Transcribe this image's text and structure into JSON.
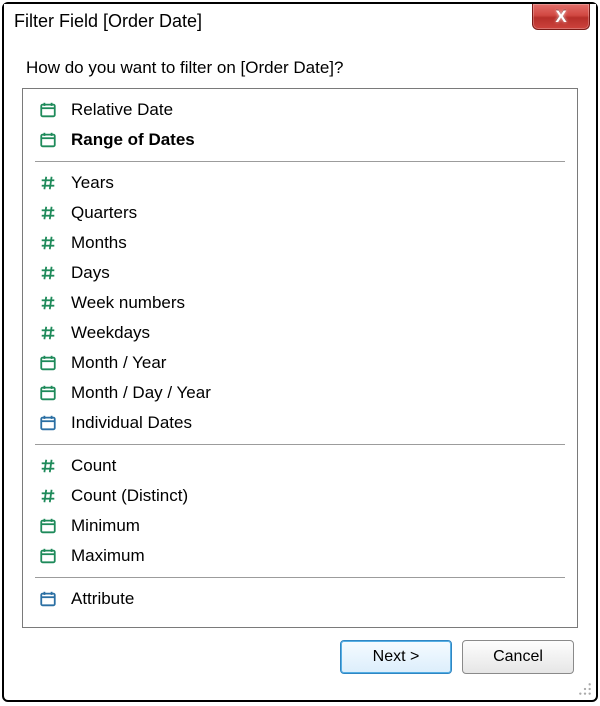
{
  "window": {
    "title": "Filter Field [Order Date]"
  },
  "prompt": "How do you want to filter on [Order Date]?",
  "groups": [
    {
      "items": [
        {
          "label": "Relative Date",
          "icon": "calendar",
          "color": "#1e8a5a",
          "selected": false
        },
        {
          "label": "Range of Dates",
          "icon": "calendar",
          "color": "#1e8a5a",
          "selected": true
        }
      ]
    },
    {
      "items": [
        {
          "label": "Years",
          "icon": "hash",
          "color": "#1e8a5a"
        },
        {
          "label": "Quarters",
          "icon": "hash",
          "color": "#1e8a5a"
        },
        {
          "label": "Months",
          "icon": "hash",
          "color": "#1e8a5a"
        },
        {
          "label": "Days",
          "icon": "hash",
          "color": "#1e8a5a"
        },
        {
          "label": "Week numbers",
          "icon": "hash",
          "color": "#1e8a5a"
        },
        {
          "label": "Weekdays",
          "icon": "hash",
          "color": "#1e8a5a"
        },
        {
          "label": "Month / Year",
          "icon": "calendar",
          "color": "#1e8a5a"
        },
        {
          "label": "Month / Day / Year",
          "icon": "calendar",
          "color": "#1e8a5a"
        },
        {
          "label": "Individual Dates",
          "icon": "calendar",
          "color": "#2b6fa3"
        }
      ]
    },
    {
      "items": [
        {
          "label": "Count",
          "icon": "hash",
          "color": "#1e8a5a"
        },
        {
          "label": "Count (Distinct)",
          "icon": "hash",
          "color": "#1e8a5a"
        },
        {
          "label": "Minimum",
          "icon": "calendar",
          "color": "#1e8a5a"
        },
        {
          "label": "Maximum",
          "icon": "calendar",
          "color": "#1e8a5a"
        }
      ]
    },
    {
      "items": [
        {
          "label": "Attribute",
          "icon": "calendar",
          "color": "#2b6fa3"
        }
      ]
    }
  ],
  "buttons": {
    "next": "Next >",
    "cancel": "Cancel"
  }
}
